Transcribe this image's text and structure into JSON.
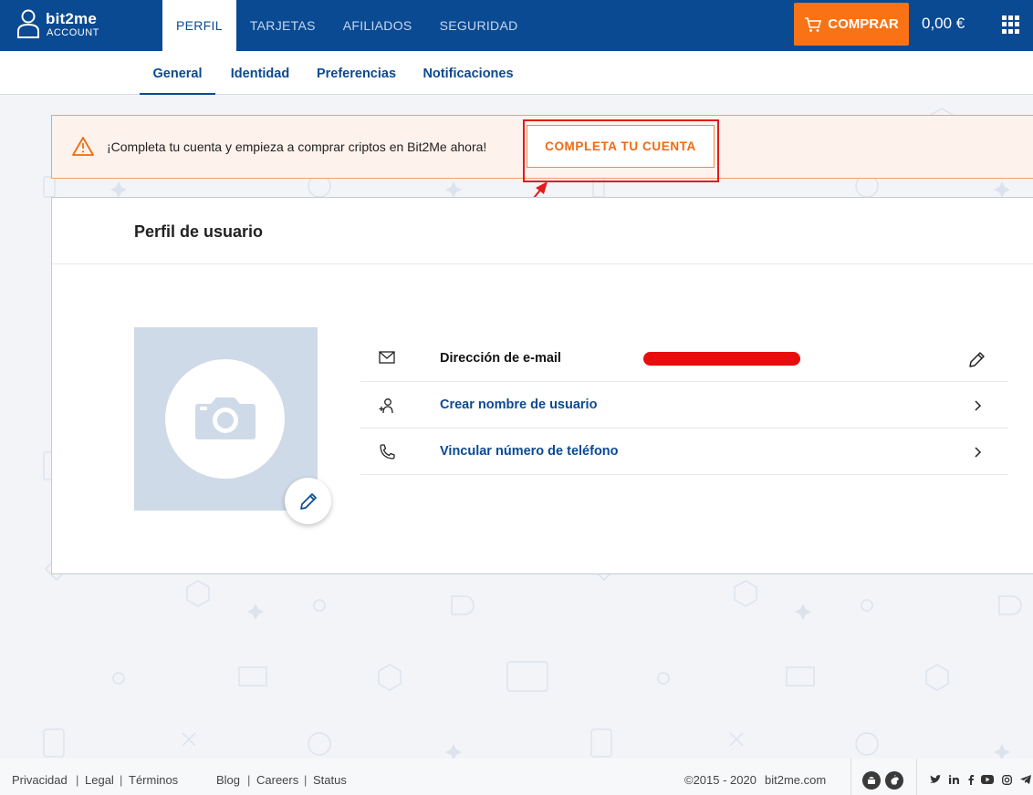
{
  "brand": {
    "name": "bit2me",
    "sub": "ACCOUNT"
  },
  "top_tabs": [
    {
      "label": "PERFIL",
      "active": true
    },
    {
      "label": "TARJETAS",
      "active": false
    },
    {
      "label": "AFILIADOS",
      "active": false
    },
    {
      "label": "SEGURIDAD",
      "active": false
    }
  ],
  "buy_label": "COMPRAR",
  "balance": "0,00 €",
  "sub_tabs": [
    {
      "label": "General",
      "active": true
    },
    {
      "label": "Identidad",
      "active": false
    },
    {
      "label": "Preferencias",
      "active": false
    },
    {
      "label": "Notificaciones",
      "active": false
    }
  ],
  "banner": {
    "message": "¡Completa tu cuenta y empieza a comprar criptos en Bit2Me ahora!",
    "button": "COMPLETA TU CUENTA"
  },
  "profile": {
    "title": "Perfil de usuario",
    "rows": [
      {
        "label": "Dirección de e-mail",
        "icon": "mail-icon",
        "action_icon": "pencil-icon",
        "value_redacted": true
      },
      {
        "label": "Crear nombre de usuario",
        "icon": "user-add-icon",
        "action_icon": "chevron-right-icon"
      },
      {
        "label": "Vincular número de teléfono",
        "icon": "phone-icon",
        "action_icon": "chevron-right-icon"
      }
    ]
  },
  "footer": {
    "links_left": [
      "Privacidad",
      "Legal",
      "Términos"
    ],
    "links_mid": [
      "Blog",
      "Careers",
      "Status"
    ],
    "copyright": "©2015 - 2020",
    "site": "bit2me.com"
  },
  "colors": {
    "primary": "#0a4a93",
    "accent": "#f97316",
    "annotation": "#e21b1b"
  }
}
